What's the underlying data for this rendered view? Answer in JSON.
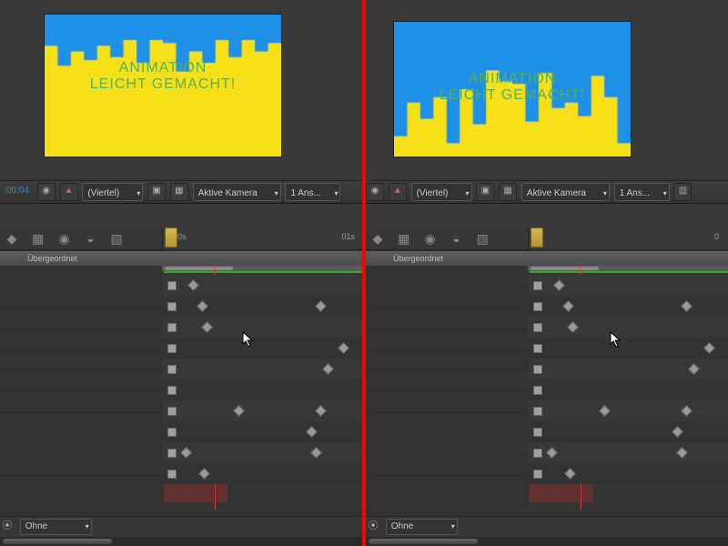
{
  "previewText": {
    "l1": "ANIMATION",
    "l2": "LEICHT GEMACHT!"
  },
  "left": {
    "bars": [
      0.22,
      0.36,
      0.26,
      0.32,
      0.22,
      0.3,
      0.18,
      0.34,
      0.18,
      0.2,
      0.4,
      0.26,
      0.34,
      0.18,
      0.3,
      0.18,
      0.26,
      0.2
    ],
    "timecode": ":00:04",
    "res": "(Viertel)",
    "camera": "Aktive Kamera",
    "views": "1 Ans...",
    "parent": "Übergeordnet",
    "rulerStart": "0s",
    "ruler01": "01s",
    "blend": "Ohne"
  },
  "right": {
    "bars": [
      0.85,
      0.6,
      0.72,
      0.56,
      0.9,
      0.5,
      0.76,
      0.36,
      0.44,
      0.46,
      0.74,
      0.38,
      0.64,
      0.6,
      0.7,
      0.4,
      0.56,
      0.9
    ],
    "res": "(Viertel)",
    "camera": "Aktive Kamera",
    "views": "1 Ans...",
    "parent": "Übergeordnet",
    "rulerEnd": "0",
    "blend": "Ohne"
  },
  "keyframes": [
    [
      [
        6,
        "h"
      ],
      [
        30,
        "d"
      ]
    ],
    [
      [
        6,
        "h"
      ],
      [
        40,
        "d"
      ],
      [
        170,
        "d"
      ]
    ],
    [
      [
        6,
        "h"
      ],
      [
        45,
        "d"
      ]
    ],
    [
      [
        6,
        "h"
      ],
      [
        195,
        "d"
      ]
    ],
    [
      [
        6,
        "h"
      ],
      [
        178,
        "d"
      ]
    ],
    [
      [
        6,
        "h"
      ]
    ],
    [
      [
        6,
        "h"
      ],
      [
        80,
        "d"
      ],
      [
        170,
        "d"
      ]
    ],
    [
      [
        6,
        "h"
      ],
      [
        160,
        "d"
      ]
    ],
    [
      [
        6,
        "h"
      ],
      [
        22,
        "d"
      ],
      [
        165,
        "d"
      ]
    ],
    [
      [
        6,
        "h"
      ],
      [
        42,
        "d"
      ]
    ]
  ],
  "playhead": 58
}
